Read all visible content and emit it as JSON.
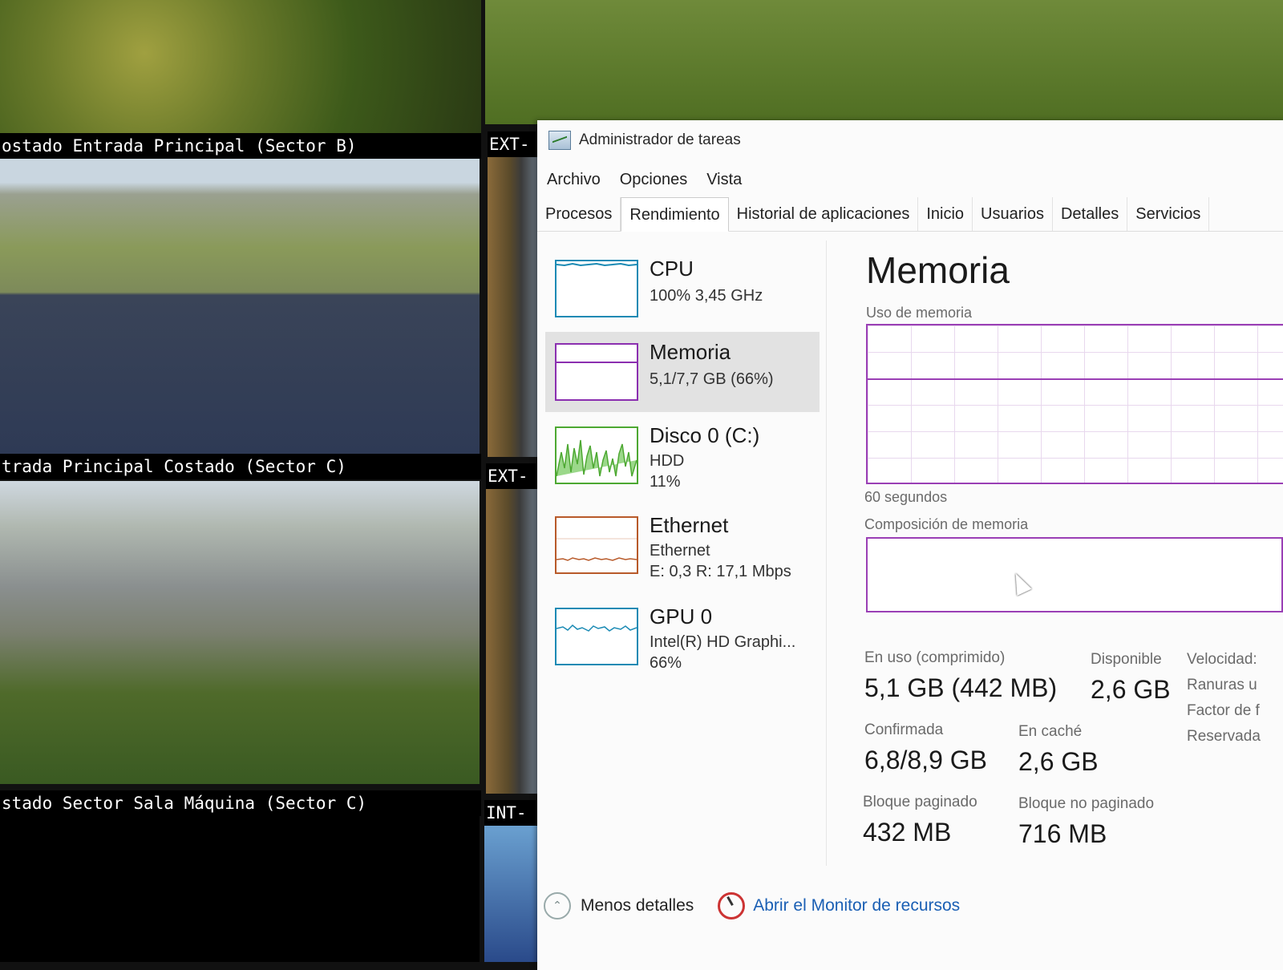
{
  "cameras": {
    "cam_top_left_label": "",
    "cam1_label": "ostado Entrada Principal (Sector B)",
    "cam2_label": "trada Principal Costado (Sector C)",
    "cam3_label": "stado Sector Sala Máquina (Sector C)",
    "strip1_label": "EXT-",
    "strip2_label": "EXT-",
    "strip3_label": "INT- F"
  },
  "window": {
    "title": "Administrador de tareas",
    "menu": [
      "Archivo",
      "Opciones",
      "Vista"
    ],
    "tabs": [
      "Procesos",
      "Rendimiento",
      "Historial de aplicaciones",
      "Inicio",
      "Usuarios",
      "Detalles",
      "Servicios"
    ],
    "active_tab": "Rendimiento"
  },
  "resources": [
    {
      "name": "CPU",
      "sub1": "100% 3,45 GHz",
      "sub2": "",
      "color": "#1a8ab4"
    },
    {
      "name": "Memoria",
      "sub1": "5,1/7,7 GB (66%)",
      "sub2": "",
      "color": "#8b2fb0"
    },
    {
      "name": "Disco 0 (C:)",
      "sub1": "HDD",
      "sub2": "11%",
      "color": "#4da832"
    },
    {
      "name": "Ethernet",
      "sub1": "Ethernet",
      "sub2": "E: 0,3 R: 17,1 Mbps",
      "color": "#b85a2a"
    },
    {
      "name": "GPU 0",
      "sub1": "Intel(R) HD Graphi...",
      "sub2": "66%",
      "color": "#1a8ab4"
    }
  ],
  "detail": {
    "title": "Memoria",
    "usage_label": "Uso de memoria",
    "time_label": "60 segundos",
    "composition_label": "Composición de memoria",
    "in_use_label": "En uso (comprimido)",
    "in_use_value": "5,1 GB (442 MB)",
    "available_label": "Disponible",
    "available_value": "2,6 GB",
    "committed_label": "Confirmada",
    "committed_value": "6,8/8,9 GB",
    "cached_label": "En caché",
    "cached_value": "2,6 GB",
    "paged_label": "Bloque paginado",
    "paged_value": "432 MB",
    "nonpaged_label": "Bloque no paginado",
    "nonpaged_value": "716 MB",
    "side_labels": [
      "Velocidad:",
      "Ranuras u",
      "Factor de f",
      "Reservada"
    ]
  },
  "footer": {
    "less_details": "Menos detalles",
    "resource_monitor": "Abrir el Monitor de recursos"
  }
}
